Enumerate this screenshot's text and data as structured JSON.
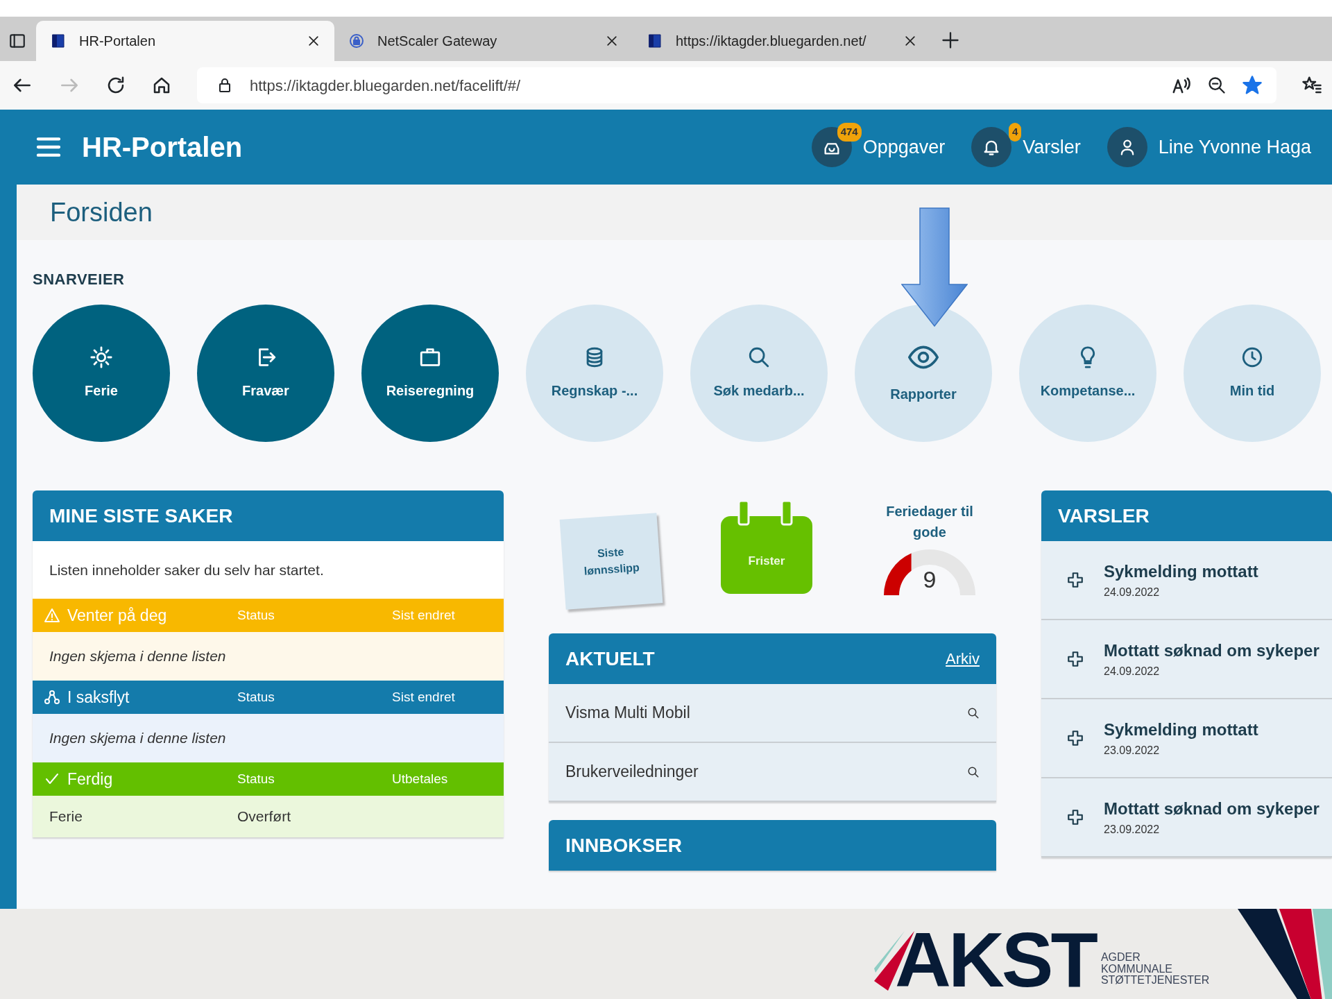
{
  "browser": {
    "tabs": [
      {
        "title": "HR-Portalen",
        "selected": true
      },
      {
        "title": "NetScaler Gateway",
        "selected": false
      },
      {
        "title": "https://iktagder.bluegarden.net/",
        "selected": false
      }
    ],
    "forward_disabled": true,
    "address": "https://iktagder.bluegarden.net/facelift/#/",
    "favorite": true
  },
  "app": {
    "title": "HR-Portalen",
    "header_buttons": [
      {
        "label": "Oppgaver",
        "badge": "474"
      },
      {
        "label": "Varsler",
        "badge": "4"
      },
      {
        "label": "Line Yvonne Haga"
      }
    ]
  },
  "page_title": "Forsiden",
  "shortcuts": {
    "title": "SNARVEIER",
    "items": [
      {
        "label": "Ferie",
        "kind": "primary"
      },
      {
        "label": "Fravær",
        "kind": "primary"
      },
      {
        "label": "Reiseregning",
        "kind": "primary"
      },
      {
        "label": "Regnskap -...",
        "kind": "secondary"
      },
      {
        "label": "Søk medarb...",
        "kind": "secondary"
      },
      {
        "label": "Rapporter",
        "kind": "secondary"
      },
      {
        "label": "Kompetanse...",
        "kind": "secondary"
      },
      {
        "label": "Min tid",
        "kind": "secondary"
      }
    ]
  },
  "my_cases": {
    "title": "MINE SISTE SAKER",
    "description": "Listen inneholder saker du selv har startet.",
    "groups": [
      {
        "kind": "waiting",
        "columns": [
          "Venter på deg",
          "Status",
          "Sist endret"
        ],
        "empty_text": "Ingen skjema i denne listen"
      },
      {
        "kind": "flow",
        "columns": [
          "I saksflyt",
          "Status",
          "Sist endret"
        ],
        "empty_text": "Ingen skjema i denne listen"
      },
      {
        "kind": "done",
        "columns": [
          "Ferdig",
          "Status",
          "Utbetales"
        ],
        "rows": [
          [
            "Ferie",
            "Overført"
          ]
        ]
      }
    ]
  },
  "widgets": {
    "payslip": "Siste lønnsslipp",
    "deadlines": "Frister",
    "vacation": {
      "title": "Feriedager til gode",
      "value": "9",
      "level": 0.3
    }
  },
  "news": {
    "title": "AKTUELT",
    "archive_link": "Arkiv",
    "items": [
      "Visma Multi Mobil",
      "Brukerveiledninger"
    ]
  },
  "inboxes": {
    "title": "INNBOKSER"
  },
  "notifications": {
    "title": "VARSLER",
    "items": [
      {
        "title": "Sykmelding mottatt",
        "date": "24.09.2022"
      },
      {
        "title": "Mottatt søknad om sykeper",
        "date": "24.09.2022"
      },
      {
        "title": "Sykmelding mottatt",
        "date": "23.09.2022"
      },
      {
        "title": "Mottatt søknad om sykeper",
        "date": "23.09.2022"
      }
    ]
  },
  "footer": {
    "logo": "AKST",
    "tagline": "AGDER KOMMUNALE STØTTETJENESTER"
  }
}
